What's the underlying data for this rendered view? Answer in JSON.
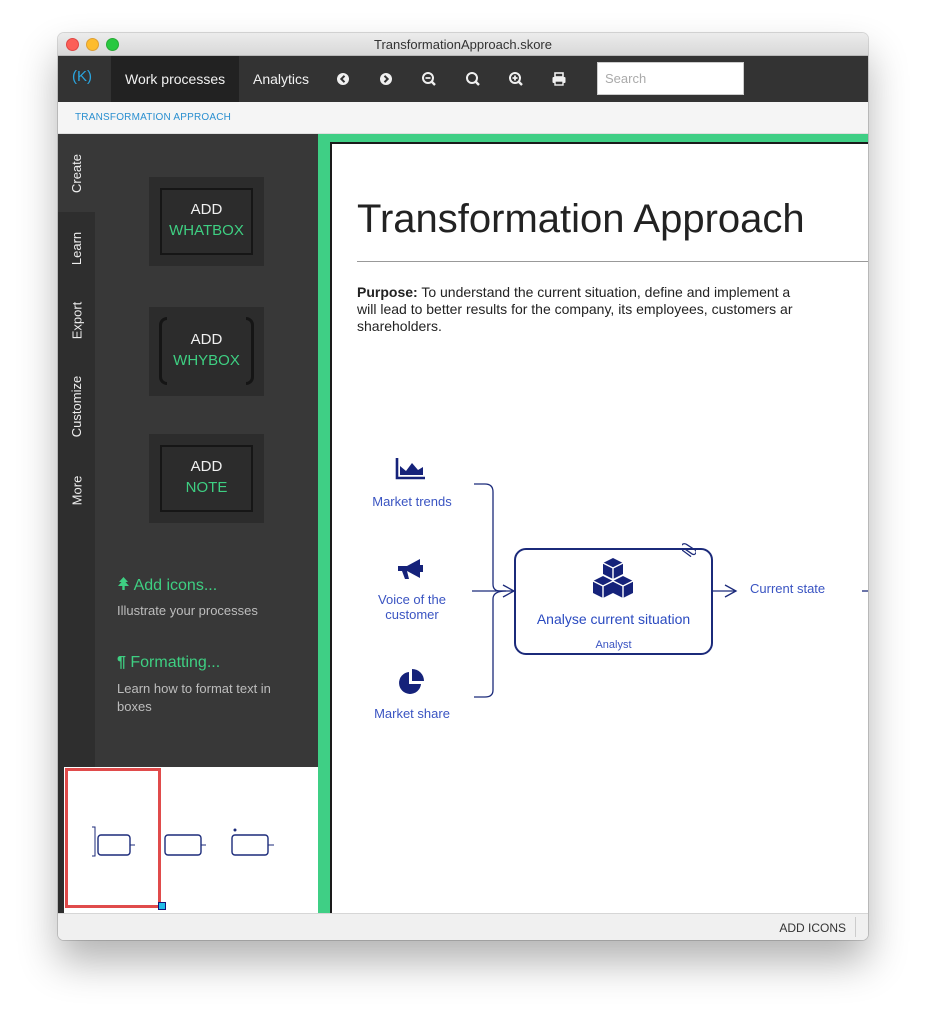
{
  "window": {
    "title": "TransformationApproach.skore"
  },
  "nav": {
    "logo": "(K)",
    "tabs": [
      {
        "label": "Work processes"
      },
      {
        "label": "Analytics"
      }
    ],
    "tools": [
      "back-icon",
      "forward-icon",
      "zoom-out-icon",
      "zoom-reset-icon",
      "zoom-in-icon",
      "print-icon"
    ],
    "search_placeholder": "Search"
  },
  "breadcrumb": "TRANSFORMATION APPROACH",
  "side_tabs": [
    "Create",
    "Learn",
    "Export",
    "Customize",
    "More"
  ],
  "panel": {
    "whatbox": {
      "line1": "ADD",
      "line2": "WHATBOX"
    },
    "whybox": {
      "line1": "ADD",
      "line2": "WHYBOX"
    },
    "note": {
      "line1": "ADD",
      "line2": "NOTE"
    },
    "add_icons": {
      "title": "Add icons...",
      "subtitle": "Illustrate your processes"
    },
    "formatting": {
      "title": "Formatting...",
      "subtitle": "Learn how to format text in boxes"
    }
  },
  "page": {
    "title": "Transformation Approach",
    "purpose_label": "Purpose:",
    "purpose_line1": " To understand the current situation, define and implement a",
    "purpose_line2": "will lead to better results for the company, its employees, customers ar",
    "purpose_line3": "shareholders."
  },
  "diagram": {
    "inputs": [
      {
        "label": "Market trends",
        "icon": "area-chart-icon"
      },
      {
        "label": "Voice of the customer",
        "icon": "megaphone-icon"
      },
      {
        "label": "Market share",
        "icon": "pie-chart-icon"
      }
    ],
    "whatbox": {
      "title": "Analyse current situation",
      "role": "Analyst",
      "icon": "cubes-icon"
    },
    "output": "Current state"
  },
  "bottom": {
    "add_icons": "ADD ICONS"
  },
  "colors": {
    "accent_green": "#3ecf82",
    "diagram_blue": "#1b2a7a",
    "text_blue": "#3a54c2",
    "selection_red": "#e04b4b"
  }
}
